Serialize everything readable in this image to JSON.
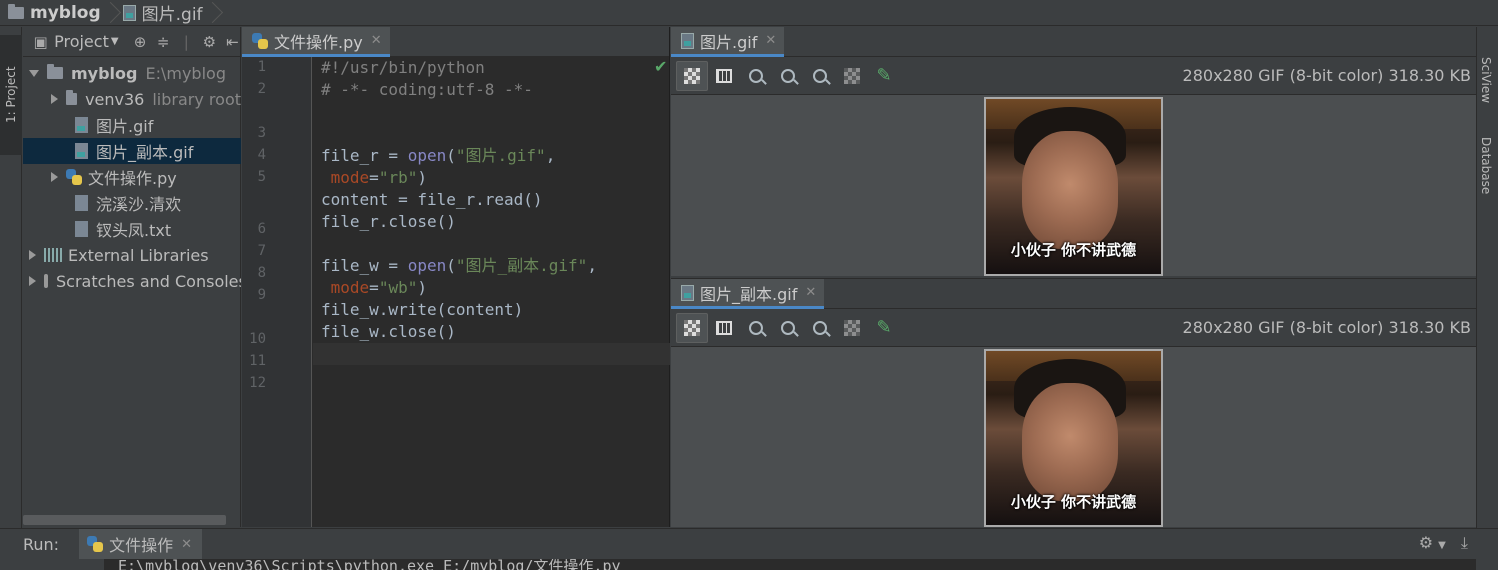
{
  "navbar": {
    "project": "myblog",
    "file": "图片.gif"
  },
  "left_strip": {
    "tab": "1: Project"
  },
  "right_strip": {
    "tab1": "SciView",
    "tab2": "Database"
  },
  "project_panel": {
    "title": "Project",
    "tree": [
      {
        "label": "myblog",
        "extra": "E:\\myblog"
      },
      {
        "label": "venv36",
        "extra": "library root"
      },
      {
        "label": "图片.gif"
      },
      {
        "label": "图片_副本.gif"
      },
      {
        "label": "文件操作.py"
      },
      {
        "label": "浣溪沙.清欢"
      },
      {
        "label": "钗头凤.txt"
      },
      {
        "label": "External Libraries"
      },
      {
        "label": "Scratches and Consoles"
      }
    ]
  },
  "editor": {
    "tab": "文件操作.py",
    "line_numbers": [
      "1",
      "2",
      "3",
      "4",
      "5",
      "6",
      "7",
      "8",
      "9",
      "10",
      "11",
      "12"
    ],
    "code": {
      "l1": "#!/usr/bin/python",
      "l2": "# -*- coding:utf-8 -*-",
      "l5a": "file_r = ",
      "l5b": "open",
      "l5c": "(",
      "l5d": "\"图片.gif\"",
      "l5e": ",",
      "l5f": " mode",
      "l5g": "=",
      "l5h": "\"rb\"",
      "l5i": ")",
      "l6": "content = file_r.read()",
      "l7": "file_r.close()",
      "l9a": "file_w = ",
      "l9b": "open",
      "l9c": "(",
      "l9d": "\"图片_副本.gif\"",
      "l9e": ",",
      "l9f": " mode",
      "l9g": "=",
      "l9h": "\"wb\"",
      "l9i": ")",
      "l10": "file_w.write(content)",
      "l11": "file_w.close()"
    }
  },
  "image_viewer_top": {
    "tab": "图片.gif",
    "info": "280x280 GIF (8-bit color) 318.30 KB",
    "caption": "小伙子 你不讲武德"
  },
  "image_viewer_bottom": {
    "tab": "图片_副本.gif",
    "info": "280x280 GIF (8-bit color) 318.30 KB",
    "caption": "小伙子 你不讲武德"
  },
  "run": {
    "label": "Run:",
    "tab": "文件操作",
    "output": "E:\\myblog\\venv36\\Scripts\\python.exe E:/myblog/文件操作.py"
  }
}
